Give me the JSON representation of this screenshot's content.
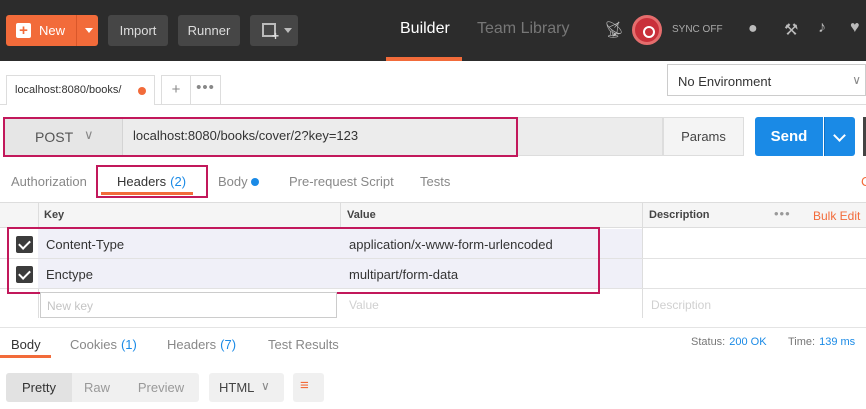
{
  "topbar": {
    "new_label": "New",
    "import_label": "Import",
    "runner_label": "Runner",
    "nav": {
      "builder": "Builder",
      "team_library": "Team Library"
    },
    "sync_label": "SYNC OFF"
  },
  "tabs": {
    "active_tab_label": "localhost:8080/books/",
    "add": "+",
    "more": "•••"
  },
  "environment": {
    "selected": "No Environment"
  },
  "request": {
    "method": "POST",
    "url": "localhost:8080/books/cover/2?key=123",
    "params_label": "Params",
    "send_label": "Send"
  },
  "subtabs": {
    "authorization": "Authorization",
    "headers": "Headers",
    "headers_count": "(2)",
    "body": "Body",
    "prerequest": "Pre-request Script",
    "tests": "Tests",
    "cut_char": "C"
  },
  "headers_table": {
    "columns": {
      "key": "Key",
      "value": "Value",
      "description": "Description"
    },
    "more": "•••",
    "bulk_edit": "Bulk Edit",
    "rows": [
      {
        "checked": true,
        "key": "Content-Type",
        "value": "application/x-www-form-urlencoded",
        "description": ""
      },
      {
        "checked": true,
        "key": "Enctype",
        "value": "multipart/form-data",
        "description": ""
      }
    ],
    "new_key_placeholder": "New key",
    "value_placeholder": "Value",
    "description_placeholder": "Description"
  },
  "response": {
    "tabs": {
      "body": "Body",
      "cookies": "Cookies",
      "cookies_count": "(1)",
      "headers": "Headers",
      "headers_count": "(7)",
      "test_results": "Test Results"
    },
    "status_label": "Status:",
    "status_value": "200 OK",
    "time_label": "Time:",
    "time_value": "139 ms",
    "view_modes": {
      "pretty": "Pretty",
      "raw": "Raw",
      "preview": "Preview"
    },
    "format": "HTML"
  },
  "colors": {
    "accent_orange": "#f26b3a",
    "send_blue": "#1a8ae6",
    "highlight_magenta": "#c2185b",
    "topbar_bg": "#2c2c2c"
  }
}
